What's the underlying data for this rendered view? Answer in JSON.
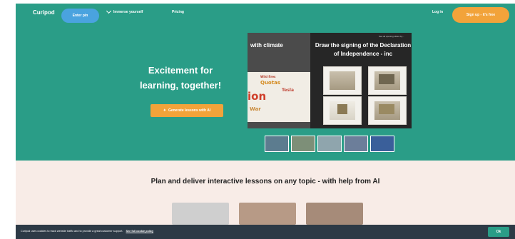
{
  "nav": {
    "logo": "Curipod",
    "enter_pin": "Enter pin",
    "immerse": "Immerse yourself",
    "pricing": "Pricing",
    "login": "Log in",
    "signup": "Sign up - it's free"
  },
  "hero": {
    "headline_line1": "Excitement for",
    "headline_line2": "learning, together!",
    "cta_label": "Generate lessons with AI",
    "cta_icon": "sparkle-icon"
  },
  "preview": {
    "left_title": "with climate",
    "word_cloud": [
      "Wild fires",
      "Quotas",
      "Tesla",
      "ion",
      "War"
    ],
    "right_small": "See all opening slides by...",
    "right_title": "Draw the signing of the Declaration of Independence - inc"
  },
  "plan": {
    "title": "Plan and deliver interactive lessons on any topic - with help from AI"
  },
  "cookie": {
    "text": "Curipod uses cookies to track website traffic and to provide a great customer support.",
    "link": "See full cookie policy",
    "ok": "Ok"
  },
  "colors": {
    "brand_green": "#2a9d87",
    "accent_orange": "#f2a33a",
    "pin_blue": "#4aa3df",
    "plan_bg": "#f8ece7",
    "cookie_bg": "#2d3a46"
  }
}
